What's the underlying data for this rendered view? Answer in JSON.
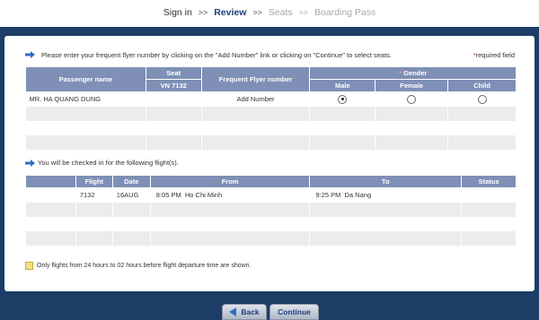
{
  "breadcrumb": {
    "steps": [
      "Sign in",
      "Review",
      "Seats",
      "Boarding Pass"
    ],
    "separator": ">>"
  },
  "instructions": "Please enter your frequent flyer number by clicking on the \"Add Number\" link or clicking on \"Continue\" to select seats.",
  "required_field": {
    "star": "*",
    "label": "required field"
  },
  "passenger_table": {
    "headers": {
      "passenger_name": "Passenger name",
      "seat": "Seat",
      "seat_flight": "VN 7132",
      "frequent_flyer": "Frequent Flyer number",
      "gender_star": "*",
      "gender": "Gender",
      "male": "Male",
      "female": "Female",
      "child": "Child"
    },
    "rows": [
      {
        "name": "MR. HA QUANG DUNG",
        "seat": "",
        "ff": "Add Number",
        "gender": "Male"
      }
    ]
  },
  "flights_caption": "You will be checked in for the following flight(s).",
  "flight_table": {
    "headers": {
      "flight": "Flight",
      "date": "Date",
      "from": "From",
      "to": "To",
      "status": "Status"
    },
    "rows": [
      {
        "flight": "7132",
        "date": "16AUG",
        "dep_time": "8:05 PM",
        "from": "Ho Chi Minh",
        "arr_time": "9:25 PM",
        "to": "Da Nang",
        "status": ""
      }
    ]
  },
  "note": "Only flights from 24 hours to 02 hours before flight departure time are shown.",
  "buttons": {
    "back": "Back",
    "continue": "Continue"
  },
  "colors": {
    "header_bg": "#7f8fb6",
    "frame": "#1b3d66",
    "row_alt": "#ececef",
    "active_step": "#1d3d7a"
  }
}
